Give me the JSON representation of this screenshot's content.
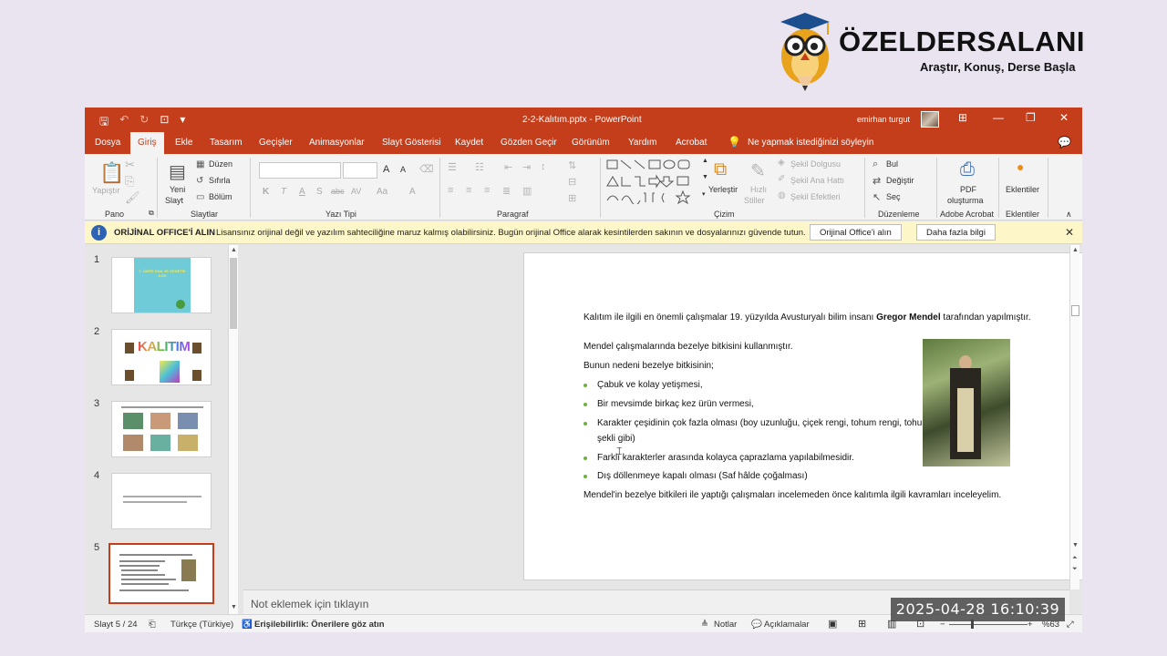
{
  "brand": {
    "title": "ÖZELDERSALANI",
    "subtitle": "Araştır, Konuş, Derse Başla"
  },
  "window": {
    "doc_title": "2-2-Kalıtım.pptx  -  PowerPoint",
    "user_name": "emirhan turgut"
  },
  "tabs": [
    {
      "label": "Dosya"
    },
    {
      "label": "Giriş"
    },
    {
      "label": "Ekle"
    },
    {
      "label": "Tasarım"
    },
    {
      "label": "Geçişler"
    },
    {
      "label": "Animasyonlar"
    },
    {
      "label": "Slayt Gösterisi"
    },
    {
      "label": "Kaydet"
    },
    {
      "label": "Gözden Geçir"
    },
    {
      "label": "Görünüm"
    },
    {
      "label": "Yardım"
    },
    {
      "label": "Acrobat"
    }
  ],
  "tell_me": "Ne yapmak istediğinizi söyleyin",
  "ribbon": {
    "pano": {
      "label": "Pano",
      "paste": "Yapıştır"
    },
    "slaytlar": {
      "label": "Slaytlar",
      "new_slide_1": "Yeni",
      "new_slide_2": "Slayt",
      "layout": "Düzen",
      "reset": "Sıfırla",
      "section": "Bölüm"
    },
    "yazi_tipi": {
      "label": "Yazı Tipi",
      "bold": "K",
      "italic": "T",
      "underline": "A",
      "shadow": "S",
      "strike": "abc",
      "spacing": "AV",
      "case": "Aa",
      "color": "A",
      "grow": "A",
      "shrink": "A"
    },
    "paragraf": {
      "label": "Paragraf"
    },
    "cizim": {
      "label": "Çizim",
      "arrange": "Yerleştir",
      "quick_styles_1": "Hızlı",
      "quick_styles_2": "Stiller",
      "shape_fill": "Şekil Dolgusu",
      "shape_outline": "Şekil Ana Hattı",
      "shape_effects": "Şekil Efektleri"
    },
    "duzenleme": {
      "label": "Düzenleme",
      "find": "Bul",
      "replace": "Değiştir",
      "select": "Seç"
    },
    "acrobat": {
      "label": "Adobe Acrobat",
      "pdf_1": "PDF",
      "pdf_2": "oluşturma"
    },
    "eklentiler": {
      "label": "Eklentiler",
      "addins": "Eklentiler"
    }
  },
  "notice": {
    "title": "ORİJİNAL OFFICE'İ ALIN",
    "message": "Lisansınız orijinal değil ve yazılım sahteciliğine maruz kalmış olabilirsiniz. Bugün orijinal Office alarak kesintilerden sakının ve dosyalarınızı güvende tutun.",
    "buy_button": "Orijinal Office'i alın",
    "more_button": "Daha fazla bilgi"
  },
  "thumbnails": [
    {
      "number": "1",
      "text": "7. ÜNİTE DNA VE GENETİK KOD"
    },
    {
      "number": "2",
      "text": "KALITIM"
    },
    {
      "number": "3",
      "text": ""
    },
    {
      "number": "4",
      "text": ""
    },
    {
      "number": "5",
      "text": ""
    }
  ],
  "slide": {
    "intro_before": "Kalıtım ile ilgili en önemli çalışmalar 19. yüzyılda Avusturyalı bilim insanı ",
    "intro_bold": "Gregor Mendel",
    "intro_after": " tarafından yapılmıştır.",
    "p1": "Mendel çalışmalarında bezelye bitkisini kullanmıştır.",
    "p2": "Bunun nedeni bezelye bitkisinin;",
    "bullets": [
      "Çabuk ve kolay yetişmesi,",
      "Bir mevsimde birkaç kez ürün vermesi,",
      "Karakter çeşidinin çok fazla olması (boy uzunluğu, çiçek rengi, tohum rengi, tohum",
      "Farklı karakterler arasında kolayca çaprazlama yapılabilmesidir.",
      "Dış döllenmeye kapalı olması (Saf hâlde çoğalması)"
    ],
    "bullet3_cont": "şekli gibi)",
    "closing": "Mendel'in bezelye bitkileri ile yaptığı çalışmaları incelemeden önce kalıtımla ilgili kavramları inceleyelim."
  },
  "notes_placeholder": "Not eklemek için tıklayın",
  "status": {
    "slide": "Slayt 5 / 24",
    "language": "Türkçe (Türkiye)",
    "accessibility": "Erişilebilirlik: Önerilere göz atın",
    "notes": "Notlar",
    "comments": "Açıklamalar",
    "zoom": "%63"
  },
  "timestamp": "2025-04-28  16:10:39",
  "colors": {
    "accent": "#c43e1c",
    "bullet": "#6bb33e",
    "notice_bg": "#fdf6c9"
  }
}
